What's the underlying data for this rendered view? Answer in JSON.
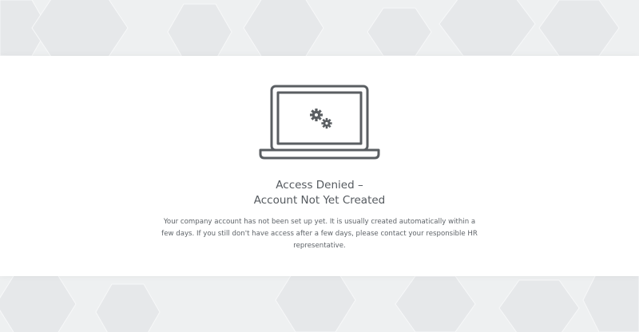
{
  "icons": {
    "illustration": "laptop-icon",
    "gears": "gears-icon"
  },
  "colors": {
    "text": "#555a5f",
    "icon_stroke": "#5a5e62",
    "background": "#f2f3f4",
    "panel": "#ffffff"
  },
  "heading": {
    "line1": "Access Denied –",
    "line2": "Account Not Yet Created"
  },
  "message": "Your company account has not been set up yet. It is usually created automatically within a few days. If you still don't have access after a few days, please contact your responsible HR representative."
}
